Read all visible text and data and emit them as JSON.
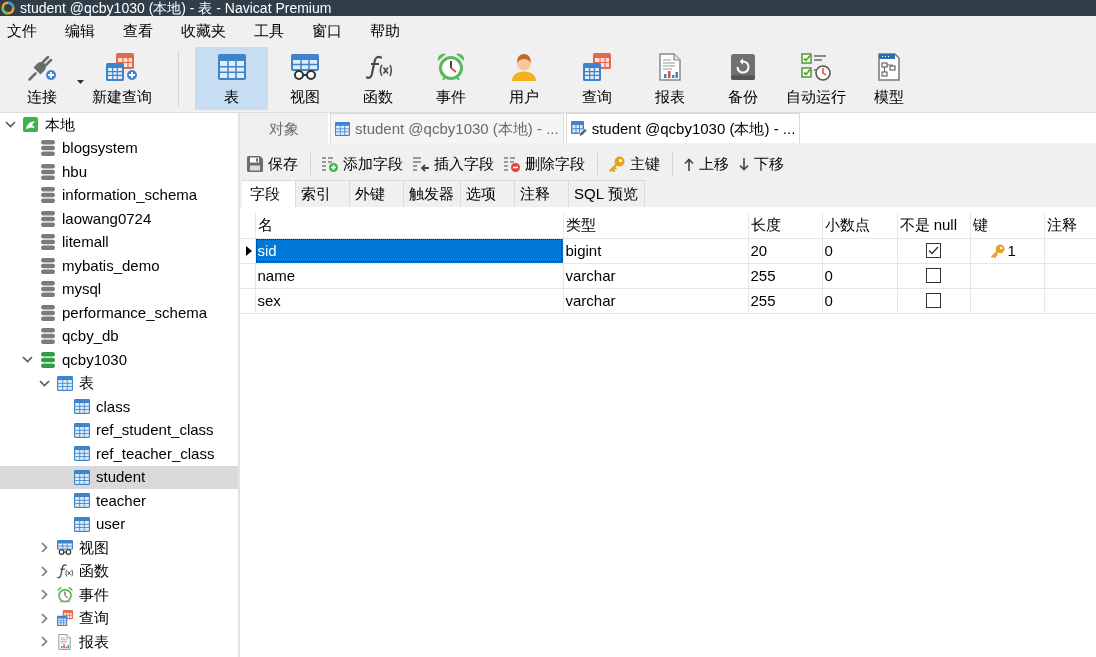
{
  "window": {
    "title": "student @qcby1030 (本地) - 表 - Navicat Premium"
  },
  "menu": [
    "文件",
    "编辑",
    "查看",
    "收藏夹",
    "工具",
    "窗口",
    "帮助"
  ],
  "toolbar": [
    {
      "items": [
        {
          "label": "连接",
          "kind": "connect",
          "dropdown": true,
          "selected": false
        },
        {
          "label": "新建查询",
          "kind": "newquery",
          "dropdown": false,
          "selected": false
        }
      ]
    },
    {
      "items": [
        {
          "label": "表",
          "kind": "table",
          "dropdown": false,
          "selected": true
        },
        {
          "label": "视图",
          "kind": "view",
          "dropdown": false,
          "selected": false
        },
        {
          "label": "函数",
          "kind": "function",
          "dropdown": false,
          "selected": false
        },
        {
          "label": "事件",
          "kind": "event",
          "dropdown": false,
          "selected": false
        },
        {
          "label": "用户",
          "kind": "user",
          "dropdown": false,
          "selected": false
        },
        {
          "label": "查询",
          "kind": "query",
          "dropdown": false,
          "selected": false
        },
        {
          "label": "报表",
          "kind": "report",
          "dropdown": false,
          "selected": false
        },
        {
          "label": "备份",
          "kind": "backup",
          "dropdown": false,
          "selected": false
        },
        {
          "label": "自动运行",
          "kind": "automation",
          "dropdown": false,
          "selected": false
        },
        {
          "label": "模型",
          "kind": "model",
          "dropdown": false,
          "selected": false
        }
      ]
    }
  ],
  "sidebar": {
    "tree": [
      {
        "label": "本地",
        "kind": "connection",
        "expanded": true,
        "selected": false,
        "children": [
          {
            "label": "blogsystem",
            "kind": "database",
            "expanded": false,
            "selected": false
          },
          {
            "label": "hbu",
            "kind": "database",
            "expanded": false,
            "selected": false
          },
          {
            "label": "information_schema",
            "kind": "database",
            "expanded": false,
            "selected": false
          },
          {
            "label": "laowang0724",
            "kind": "database",
            "expanded": false,
            "selected": false
          },
          {
            "label": "litemall",
            "kind": "database",
            "expanded": false,
            "selected": false
          },
          {
            "label": "mybatis_demo",
            "kind": "database",
            "expanded": false,
            "selected": false
          },
          {
            "label": "mysql",
            "kind": "database",
            "expanded": false,
            "selected": false
          },
          {
            "label": "performance_schema",
            "kind": "database",
            "expanded": false,
            "selected": false
          },
          {
            "label": "qcby_db",
            "kind": "database",
            "expanded": false,
            "selected": false
          },
          {
            "label": "qcby1030",
            "kind": "database",
            "expanded": true,
            "selected": false,
            "children": [
              {
                "label": "表",
                "kind": "tables",
                "expanded": true,
                "selected": false,
                "children": [
                  {
                    "label": "class",
                    "kind": "table",
                    "selected": false
                  },
                  {
                    "label": "ref_student_class",
                    "kind": "table",
                    "selected": false
                  },
                  {
                    "label": "ref_teacher_class",
                    "kind": "table",
                    "selected": false
                  },
                  {
                    "label": "student",
                    "kind": "table",
                    "selected": true
                  },
                  {
                    "label": "teacher",
                    "kind": "table",
                    "selected": false
                  },
                  {
                    "label": "user",
                    "kind": "table",
                    "selected": false
                  }
                ]
              },
              {
                "label": "视图",
                "kind": "views",
                "expanded": false,
                "selected": false
              },
              {
                "label": "函数",
                "kind": "functions",
                "expanded": false,
                "selected": false
              },
              {
                "label": "事件",
                "kind": "events",
                "expanded": false,
                "selected": false
              },
              {
                "label": "查询",
                "kind": "queries",
                "expanded": false,
                "selected": false
              },
              {
                "label": "报表",
                "kind": "reports",
                "expanded": false,
                "selected": false
              }
            ]
          }
        ]
      }
    ]
  },
  "tabs": [
    {
      "label": "对象",
      "kind": "objects",
      "selected": false
    },
    {
      "label": "student @qcby1030 (本地) - ...",
      "kind": "table",
      "selected": false
    },
    {
      "label": "student @qcby1030 (本地) - ...",
      "kind": "design",
      "selected": true
    }
  ],
  "editor_toolbar": [
    {
      "items": [
        {
          "label": "保存",
          "kind": "save"
        }
      ]
    },
    {
      "items": [
        {
          "label": "添加字段",
          "kind": "add"
        },
        {
          "label": "插入字段",
          "kind": "insert"
        },
        {
          "label": "删除字段",
          "kind": "delete"
        }
      ]
    },
    {
      "items": [
        {
          "label": "主键",
          "kind": "key"
        }
      ]
    },
    {
      "items": [
        {
          "label": "上移",
          "kind": "up"
        },
        {
          "label": "下移",
          "kind": "down"
        }
      ]
    }
  ],
  "subtabs": [
    {
      "label": "字段",
      "selected": true
    },
    {
      "label": "索引",
      "selected": false
    },
    {
      "label": "外键",
      "selected": false
    },
    {
      "label": "触发器",
      "selected": false
    },
    {
      "label": "选项",
      "selected": false
    },
    {
      "label": "注释",
      "selected": false
    },
    {
      "label": "SQL 预览",
      "selected": false
    }
  ],
  "grid": {
    "columns": [
      "名",
      "类型",
      "长度",
      "小数点",
      "不是 null",
      "键",
      "注释"
    ],
    "rows": [
      {
        "selected": true,
        "name": "sid",
        "type": "bigint",
        "length": "20",
        "decimals": "0",
        "not_null": true,
        "key": "1"
      },
      {
        "selected": false,
        "name": "name",
        "type": "varchar",
        "length": "255",
        "decimals": "0",
        "not_null": false
      },
      {
        "selected": false,
        "name": "sex",
        "type": "varchar",
        "length": "255",
        "decimals": "0",
        "not_null": false
      }
    ]
  }
}
